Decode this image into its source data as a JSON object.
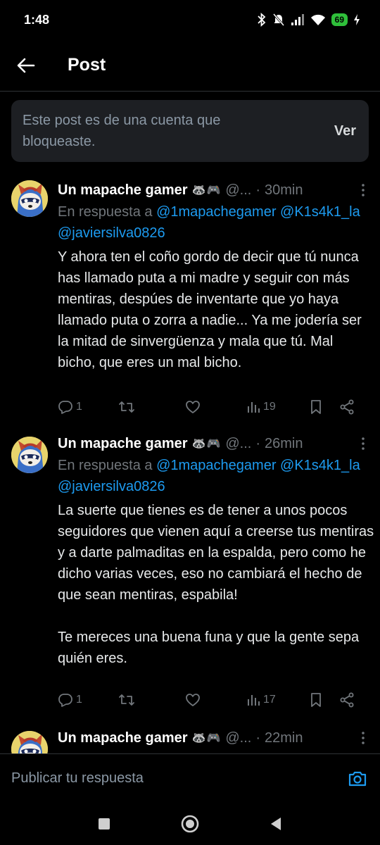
{
  "status_bar": {
    "time": "1:48",
    "battery": "69"
  },
  "header": {
    "title": "Post"
  },
  "blocked_notice": {
    "text": "Este post es de una cuenta que bloqueaste.",
    "view_label": "Ver"
  },
  "replies": [
    {
      "author_name": "Un mapache gamer",
      "author_emoji": "🦝🎮",
      "handle": "@...",
      "time": "30min",
      "reply_prefix": "En respuesta a",
      "mentions_line1": "@1mapachegamer @K1s4k1_la",
      "mentions_line2": "@javiersilva0826",
      "text": "Y ahora ten el coño gordo de decir que tú nunca has llamado puta a mi madre y seguir con más mentiras, despúes de inventarte que yo haya llamado puta o zorra a nadie... Ya me jodería ser la mitad de sinvergüenza y mala que tú. Mal bicho, que eres un mal bicho.",
      "replies_count": "1",
      "views_count": "19"
    },
    {
      "author_name": "Un mapache gamer",
      "author_emoji": "🦝🎮",
      "handle": "@...",
      "time": "26min",
      "reply_prefix": "En respuesta a",
      "mentions_line1": "@1mapachegamer @K1s4k1_la",
      "mentions_line2": "@javiersilva0826",
      "text": "La suerte que tienes es de tener a unos pocos seguidores que vienen aquí a creerse tus mentiras y a darte palmaditas en la espalda, pero como he dicho varias veces, eso no cambiará el hecho de que sean mentiras, espabila!\n\nTe mereces una buena funa y que la gente sepa quién eres.",
      "replies_count": "1",
      "views_count": "17"
    },
    {
      "author_name": "Un mapache gamer",
      "author_emoji": "🦝🎮",
      "handle": "@...",
      "time": "22min"
    }
  ],
  "compose": {
    "placeholder": "Publicar tu respuesta"
  },
  "icons": {
    "back": "arrow-left-icon",
    "more": "more-vertical-icon",
    "reply": "comment-icon",
    "retweet": "repost-icon",
    "like": "heart-icon",
    "views": "bar-chart-icon",
    "bookmark": "bookmark-icon",
    "share": "share-icon",
    "camera": "camera-icon"
  },
  "colors": {
    "background": "#000000",
    "accent": "#1d9bf0",
    "muted": "#71767b",
    "battery": "#2fbf3a"
  }
}
